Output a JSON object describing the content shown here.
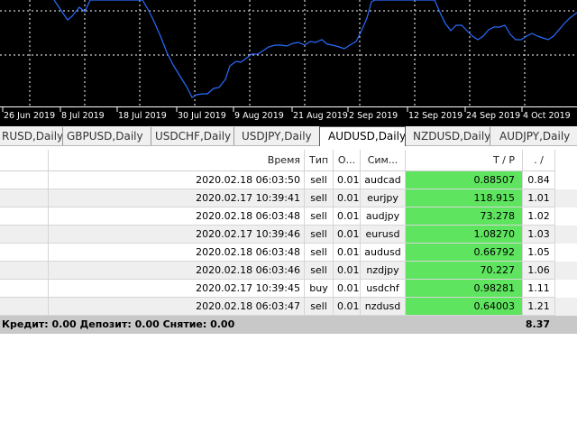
{
  "chart": {
    "background": "#000000",
    "line_color": "#2a6cff",
    "grid_color": "#ffffff",
    "x_labels": [
      "26 Jun 2019",
      "8 Jul 2019",
      "18 Jul 2019",
      "30 Jul 2019",
      "9 Aug 2019",
      "21 Aug 2019",
      "2 Sep 2019",
      "12 Sep 2019",
      "24 Sep 2019",
      "4 Oct 2019"
    ]
  },
  "tabs": [
    "RUSD,Daily",
    "GBPUSD,Daily",
    "USDCHF,Daily",
    "USDJPY,Daily",
    "AUDUSD,Daily",
    "NZDUSD,Daily",
    "AUDJPY,Daily"
  ],
  "active_tab": "AUDUSD,Daily",
  "table": {
    "headers": {
      "time": "Время",
      "type": "Тип",
      "volume": "О...",
      "symbol": "Сим...",
      "tp": "T / P",
      "price": ". /"
    },
    "rows": [
      {
        "time": "2020.02.18 06:03:50",
        "type": "sell",
        "volume": "0.01",
        "symbol": "audcad",
        "tp": "0.88507",
        "price": "0.84"
      },
      {
        "time": "2020.02.17 10:39:41",
        "type": "sell",
        "volume": "0.01",
        "symbol": "eurjpy",
        "tp": "118.915",
        "price": "1.01"
      },
      {
        "time": "2020.02.18 06:03:48",
        "type": "sell",
        "volume": "0.01",
        "symbol": "audjpy",
        "tp": "73.278",
        "price": "1.02"
      },
      {
        "time": "2020.02.17 10:39:46",
        "type": "sell",
        "volume": "0.01",
        "symbol": "eurusd",
        "tp": "1.08270",
        "price": "1.03"
      },
      {
        "time": "2020.02.18 06:03:48",
        "type": "sell",
        "volume": "0.01",
        "symbol": "audusd",
        "tp": "0.66792",
        "price": "1.05"
      },
      {
        "time": "2020.02.18 06:03:46",
        "type": "sell",
        "volume": "0.01",
        "symbol": "nzdjpy",
        "tp": "70.227",
        "price": "1.06"
      },
      {
        "time": "2020.02.17 10:39:45",
        "type": "buy",
        "volume": "0.01",
        "symbol": "usdchf",
        "tp": "0.98281",
        "price": "1.11"
      },
      {
        "time": "2020.02.18 06:03:47",
        "type": "sell",
        "volume": "0.01",
        "symbol": "nzdusd",
        "tp": "0.64003",
        "price": "1.21"
      }
    ],
    "tp_color": "#5ee45e",
    "footer": {
      "summary": "Кредит: 0.00  Депозит: 0.00  Снятие: 0.00",
      "total": "8.37"
    }
  }
}
